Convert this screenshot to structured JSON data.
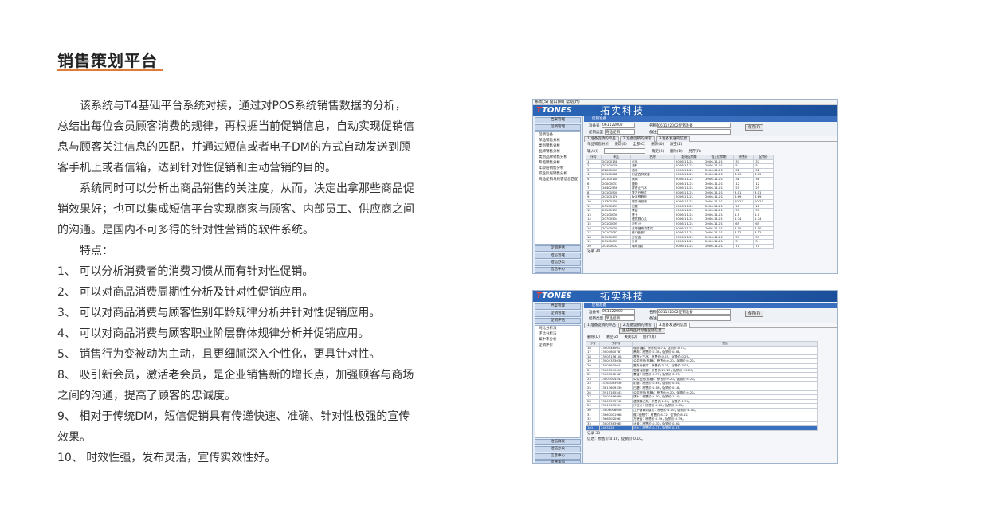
{
  "page": {
    "title": "销售策划平台",
    "paragraphs": [
      "该系统与T4基础平台系统对接，通过对POS系统销售数据的分析，总结出每位会员顾客消费的规律，再根据当前促销信息，自动实现促销信息与顾客关注信息的匹配，并通过短信或者电子DM的方式自动发送到顾客手机上或者信箱，达到针对性促销和主动营销的目的。",
      "系统同时可以分析出商品销售的关注度，从而，决定出拿那些商品促销效果好；也可以集成短信平台实现商家与顾客、内部员工、供应商之间的沟通。是国内不可多得的针对性营销的软件系统。"
    ],
    "features_label": "特点：",
    "features": [
      "1、 可以分析消费者的消费习惯从而有针对性促销。",
      "2、 可以对商品消费周期性分析及针对性促销应用。",
      "3、 可以对商品消费与顾客性别年龄规律分析并针对性促销应用。",
      "4、 可以对商品消费与顾客职业阶层群体规律分析并促销应用。",
      "5、 销售行为变被动为主动，且更细腻深入个性化，更具针对性。",
      "8、 吸引新会员，激活老会员，是企业销售新的增长点，加强顾客与商场之间的沟通，提高了顾客的忠诚度。",
      "9、 相对于传统DM，短信促销具有传递快速、准确、针对性极强的宣传效果。",
      "10、 时效性强，发布灵活，宣传实效性好。"
    ]
  },
  "shot1": {
    "menu": "系统(S)  窗口(W)  帮助(H)",
    "logo_main": "TONES",
    "company": "拓实科技",
    "nav_top": [
      "档案管理",
      "促销管理"
    ],
    "tree": [
      "促销准备",
      "单品销售分析",
      "类别销售分析",
      "品牌销售分析",
      "类别品牌销售分析",
      "专柜销售分析",
      "年龄层销售分析",
      "职业阶层销售分析",
      "商品促销与顾客信息匹配"
    ],
    "nav_bottom": [
      "促销评估",
      "短信管理",
      "短信办公",
      "信息中心",
      "资费查询"
    ],
    "window_title": "促销准备",
    "form": {
      "no_label": "准备号",
      "no_value": "061122002",
      "name_label": "名称",
      "name_value": "061122002促销准备",
      "type_label": "促销类型",
      "type_value": "商品促销",
      "note_label": "备注",
      "save": "保存(F)"
    },
    "tabs": [
      "1.准备促销的单品",
      "2.准备促销的顾客",
      "3.准备发送的信息"
    ],
    "toolbar": [
      "单品销售分析",
      "更改(E)",
      "全部(C)",
      "删除(D)",
      "清空(Z)"
    ],
    "filter_label": "输入(I)",
    "filter_btns": [
      "确定(B)",
      "删除(D)",
      "另存(R)"
    ],
    "columns": [
      "序号",
      "单品",
      "名称",
      "起始促销期",
      "截止促销期",
      "原售价",
      "促销价"
    ],
    "rows": [
      [
        "1",
        "20100158",
        "可乐",
        "2006-11-21",
        "2006-11-21",
        ".37",
        ".37"
      ],
      [
        "2",
        "20100076",
        "油料",
        "2006-11-21",
        "2006-11-21",
        ".5",
        ".5"
      ],
      [
        "3",
        "22000043",
        "酒水",
        "2006-11-21",
        "2006-11-21",
        ".32",
        ".32"
      ],
      [
        "4",
        "20100082",
        "阿波西林胶囊",
        "2006-11-21",
        "2006-11-21",
        "6.69",
        "6.69"
      ],
      [
        "5",
        "20100140",
        "酱肉",
        "2006-11-21",
        "2006-11-21",
        ".38",
        ".38"
      ],
      [
        "6",
        "20000031",
        "酸奶",
        "2006-11-21",
        "2006-11-21",
        ".12",
        ".12"
      ],
      [
        "7",
        "16402556",
        "藿香正气水",
        "2006-11-21",
        "2006-11-21",
        ".25",
        ".25"
      ],
      [
        "8",
        "20100500",
        "复方丹参片",
        "2006-11-21",
        "2006-11-21",
        "3.01",
        "3.01"
      ],
      [
        "9",
        "20100176",
        "板蓝根颗粒",
        "2006-11-21",
        "2006-11-21",
        "6.69",
        "6.69"
      ],
      [
        "10",
        "11300130",
        "感冒清胶囊",
        "2006-11-21",
        "2006-11-21",
        "20.23",
        "20.23"
      ],
      [
        "11",
        "20100039",
        "白糖",
        "2006-11-21",
        "2006-11-21",
        ".18",
        ".18"
      ],
      [
        "12",
        "20100133",
        "食盐",
        "2006-11-21",
        "2006-11-21",
        ".37",
        ".37"
      ],
      [
        "13",
        "20100030",
        "饼干",
        "2006-11-21",
        "2006-11-21",
        "1.1",
        "1.1"
      ],
      [
        "14",
        "20700504",
        "速效救心丸",
        "2006-11-21",
        "2006-11-21",
        "1.74",
        "1.74"
      ],
      [
        "15",
        "20100095",
        "沙拉汁",
        "2006-11-21",
        "2006-11-21",
        ".65",
        ".65"
      ],
      [
        "16",
        "20100030",
        "江中健胃消食片",
        "2006-11-21",
        "2006-11-21",
        "4.10",
        "4.10"
      ],
      [
        "17",
        "20107082",
        "维C银翘片",
        "2006-11-21",
        "2006-11-21",
        "8.12",
        "8.12"
      ],
      [
        "18",
        "20100033",
        "方便面",
        "2006-11-21",
        "2006-11-21",
        ".39",
        ".39"
      ],
      [
        "19",
        "20100033",
        "牙膏",
        "2006-11-21",
        "2006-11-21",
        ".3",
        ".3"
      ],
      [
        "20",
        "20100032",
        "咖啡(罐)",
        "2006-11-21",
        "2006-11-21",
        ".71",
        ".71"
      ]
    ],
    "status": "记录 34"
  },
  "shot2": {
    "logo_main": "TONES",
    "company": "拓实科技",
    "nav_top": [
      "档案管理",
      "促销管理",
      "促销评估"
    ],
    "tree": [
      "同比分析法",
      "环比分析法",
      "案中率分析",
      "促销评价"
    ],
    "nav_bottom": [
      "短信群发",
      "短信办公",
      "信息中心",
      "资费查询"
    ],
    "window_title": "促销准备",
    "form": {
      "no_label": "准备号",
      "no_value": "061122002",
      "name_label": "名称",
      "name_value": "061122002促销准备",
      "type_label": "促销类型",
      "type_value": "单品促销",
      "note_label": "备注",
      "save": "保存(F)"
    },
    "tabs": [
      "1.准备促销的单品",
      "2.准备促销的顾客",
      "3.准备发送的信息"
    ],
    "gen_button": "生成商品针对性促销信息",
    "toolbar": [
      "删除(D)",
      "清空(Z)",
      "关闭(Q)",
      "执行(Q)"
    ],
    "columns": [
      "序号",
      "手机号",
      "信息"
    ],
    "rows": [
      [
        "16",
        "13004480011",
        "咖啡(罐)：原售价:0.71，促销价:0.71。"
      ],
      [
        "17",
        "13004800787",
        "酱肉：原售价:0.38，促销价:0.38。"
      ],
      [
        "18",
        "13905156108",
        "藿香正气水：原售价:0.25，促销价:0.25。"
      ],
      [
        "19",
        "13004353038",
        "公用白纸(纸箱)：原售价:0.20，促销价:0.20。"
      ],
      [
        "20",
        "13005630041",
        "复方丹参片：原售价:3.01，促销价:3.01。"
      ],
      [
        "21",
        "13005049012",
        "感冒清胶囊：原售价:20.23，促销价:20.23。"
      ],
      [
        "22",
        "13005502987",
        "食盐：原售价:0.37，促销价:0.37。"
      ],
      [
        "23",
        "13003004443",
        "公用白纸(纸箱)：原售价:0.20，促销价:0.20。"
      ],
      [
        "24",
        "13763083936",
        "奶酪：原售价:0.65，促销价:0.65。"
      ],
      [
        "25",
        "13813609330",
        "白糖：原售价:0.18，促销价:0.18。"
      ],
      [
        "26",
        "13915185543",
        "公用白纸(纸箱)：原售价:0.20，促销价:0.20。"
      ],
      [
        "27",
        "13003466980",
        "饼干：原售价:1.10，促销价:1.10。"
      ],
      [
        "28",
        "13803333742",
        "速效救心丸：原售价:1.74，促销价:1.74。"
      ],
      [
        "29",
        "13013435511",
        "沙拉汁：原售价:0.65，促销价:0.65。"
      ],
      [
        "30",
        "13006006056",
        "江中健胃消食片：原售价:4.10，促销价:4.10。"
      ],
      [
        "31",
        "13667001968",
        "维C银翘片：原售价:8.12，促销价:8.12。"
      ],
      [
        "32",
        "13665020961",
        "方便面：原售价:0.39，促销价:0.39。"
      ],
      [
        "33",
        "13005363985",
        "牙膏：原售价:0.30，促销价:0.30。"
      ],
      [
        "101",
        "2463128",
        "可乐：原售价:0.37，促销价:0.37。"
      ]
    ],
    "status": "记录 33",
    "footer": "信息：原售价:0.10，促销价:0.10。"
  }
}
